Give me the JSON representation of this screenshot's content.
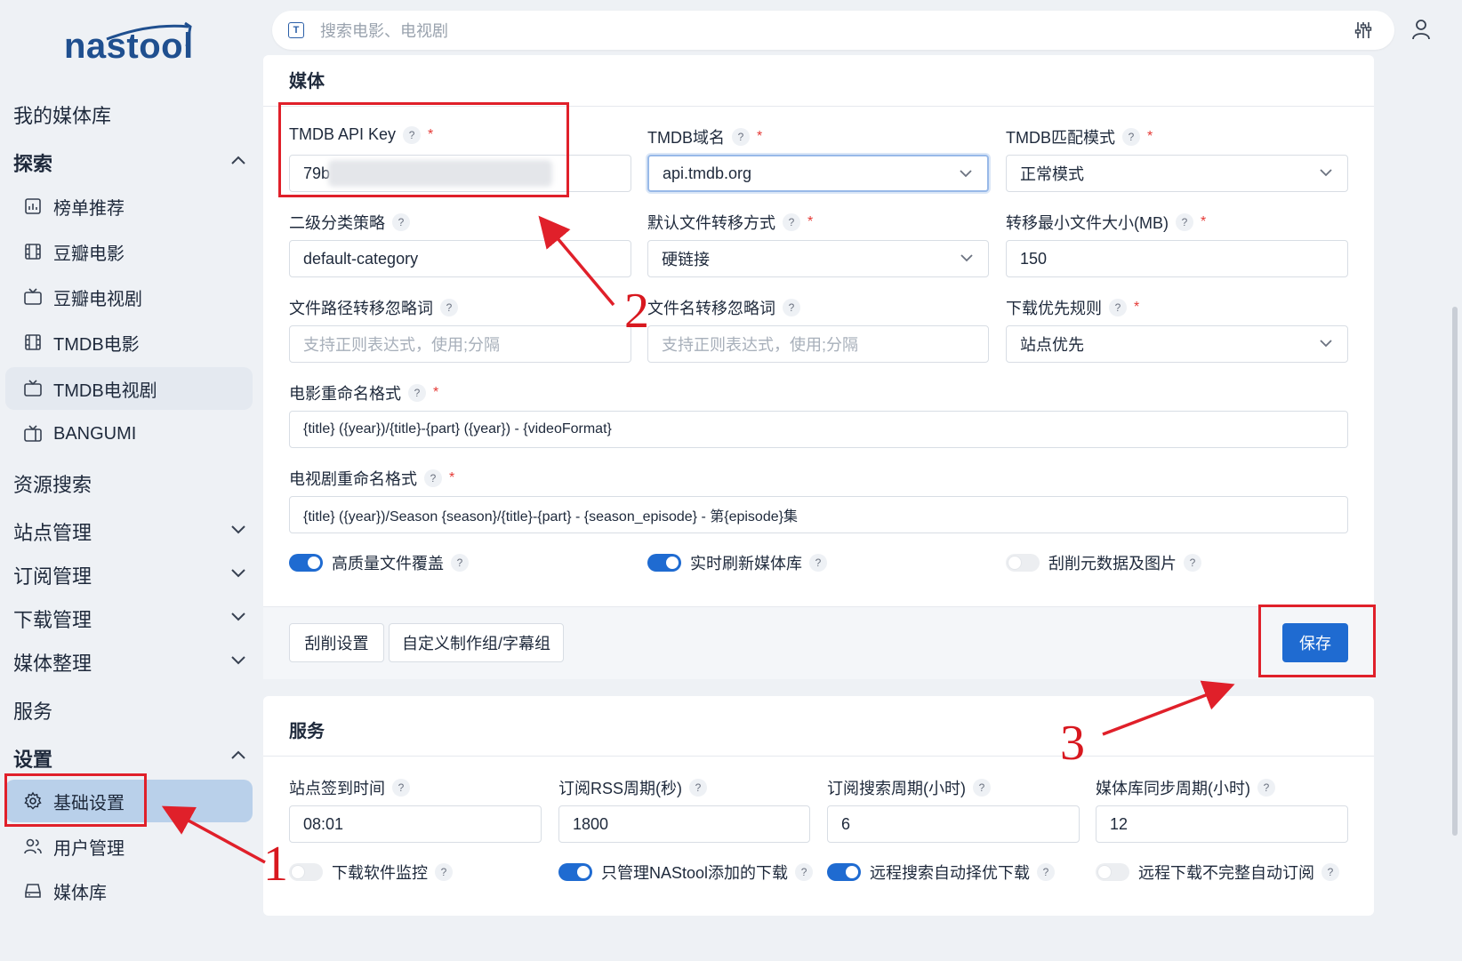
{
  "app": {
    "logo": "nastool"
  },
  "search": {
    "placeholder": "搜索电影、电视剧",
    "t_badge": "T"
  },
  "sidebar": {
    "my_library": "我的媒体库",
    "explore": "探索",
    "explore_items": [
      "榜单推荐",
      "豆瓣电影",
      "豆瓣电视剧",
      "TMDB电影",
      "TMDB电视剧",
      "BANGUMI"
    ],
    "resource_search": "资源搜索",
    "site_manage": "站点管理",
    "subscribe_manage": "订阅管理",
    "download_manage": "下载管理",
    "media_organize": "媒体整理",
    "service": "服务",
    "settings": "设置",
    "settings_items": [
      "基础设置",
      "用户管理",
      "媒体库"
    ]
  },
  "media_card": {
    "title": "媒体",
    "tmdb_api_key": {
      "label": "TMDB API Key",
      "value": "79b"
    },
    "tmdb_domain": {
      "label": "TMDB域名",
      "value": "api.tmdb.org"
    },
    "tmdb_match": {
      "label": "TMDB匹配模式",
      "value": "正常模式"
    },
    "category_strategy": {
      "label": "二级分类策略",
      "value": "default-category"
    },
    "transfer_mode": {
      "label": "默认文件转移方式",
      "value": "硬链接"
    },
    "min_file_size": {
      "label": "转移最小文件大小(MB)",
      "value": "150"
    },
    "path_ignore": {
      "label": "文件路径转移忽略词",
      "placeholder": "支持正则表达式，使用;分隔"
    },
    "name_ignore": {
      "label": "文件名转移忽略词",
      "placeholder": "支持正则表达式，使用;分隔"
    },
    "download_rule": {
      "label": "下载优先规则",
      "value": "站点优先"
    },
    "movie_rename": {
      "label": "电影重命名格式",
      "value": "{title} ({year})/{title}-{part} ({year}) - {videoFormat}"
    },
    "tv_rename": {
      "label": "电视剧重命名格式",
      "value": "{title} ({year})/Season {season}/{title}-{part} - {season_episode} - 第{episode}集"
    },
    "toggles": [
      {
        "label": "高质量文件覆盖",
        "on": true
      },
      {
        "label": "实时刷新媒体库",
        "on": true
      },
      {
        "label": "刮削元数据及图片",
        "on": false
      }
    ],
    "btn_scrape": "刮削设置",
    "btn_custom_group": "自定义制作组/字幕组",
    "btn_save": "保存"
  },
  "service_card": {
    "title": "服务",
    "fields": [
      {
        "label": "站点签到时间",
        "value": "08:01"
      },
      {
        "label": "订阅RSS周期(秒)",
        "value": "1800"
      },
      {
        "label": "订阅搜索周期(小时)",
        "value": "6"
      },
      {
        "label": "媒体库同步周期(小时)",
        "value": "12"
      }
    ],
    "toggles": [
      {
        "label": "下载软件监控",
        "on": false
      },
      {
        "label": "只管理NAStool添加的下载",
        "on": true
      },
      {
        "label": "远程搜索自动择优下载",
        "on": true
      },
      {
        "label": "远程下载不完整自动订阅",
        "on": false
      }
    ]
  },
  "annotations": {
    "n1": "1",
    "n2": "2",
    "n3": "3"
  },
  "colors": {
    "accent": "#1f6bd1",
    "annotation": "#e0202a",
    "active_nav": "#b9d0ea"
  }
}
